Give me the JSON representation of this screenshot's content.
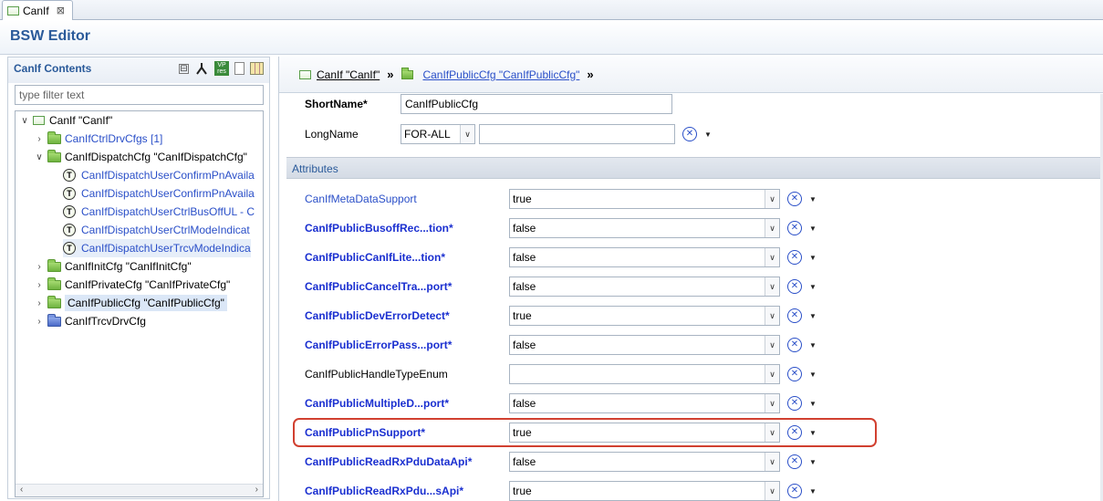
{
  "editor_tab": {
    "label": "CanIf",
    "close": "⊠"
  },
  "editor": {
    "title": "BSW Editor"
  },
  "left_panel": {
    "title": "CanIf Contents",
    "filter_placeholder": "type filter text",
    "toolbar": {
      "collapse": "⊟",
      "vp_top": "VP",
      "vp_bottom": "res"
    },
    "tree": {
      "root": {
        "label": "CanIf \"CanIf\"",
        "chevron": "∨"
      },
      "items": [
        {
          "label": "CanIfCtrlDrvCfgs [1]",
          "chevron": "›"
        },
        {
          "label": "CanIfDispatchCfg \"CanIfDispatchCfg\"",
          "chevron": "∨"
        },
        {
          "label": "CanIfDispatchUserConfirmPnAvaila",
          "icon": "T"
        },
        {
          "label": "CanIfDispatchUserConfirmPnAvaila",
          "icon": "T"
        },
        {
          "label": "CanIfDispatchUserCtrlBusOffUL - C",
          "icon": "T"
        },
        {
          "label": "CanIfDispatchUserCtrlModeIndicat",
          "icon": "T"
        },
        {
          "label": "CanIfDispatchUserTrcvModeIndica",
          "icon": "T"
        },
        {
          "label": "CanIfInitCfg \"CanIfInitCfg\"",
          "chevron": "›"
        },
        {
          "label": "CanIfPrivateCfg \"CanIfPrivateCfg\"",
          "chevron": "›"
        },
        {
          "label": "CanIfPublicCfg \"CanIfPublicCfg\"",
          "chevron": "›"
        },
        {
          "label": "CanIfTrcvDrvCfg",
          "chevron": "›"
        }
      ]
    },
    "scroll_left": "‹",
    "scroll_right": "›"
  },
  "breadcrumb": {
    "item1": "CanIf \"CanIf\"",
    "sep": "»",
    "item2": "CanIfPublicCfg \"CanIfPublicCfg\""
  },
  "form": {
    "shortname_label": "ShortName*",
    "shortname_value": "CanIfPublicCfg",
    "longname_label": "LongName",
    "longname_lang": "FOR-ALL",
    "longname_value": "",
    "section_title": "Attributes",
    "clear_symbol": "✕",
    "dropdown_symbol": "▼",
    "combo_arrow": "∨",
    "attributes": [
      {
        "label": "CanIfMetaDataSupport",
        "value": "true"
      },
      {
        "label": "CanIfPublicBusoffRec...tion*",
        "value": "false"
      },
      {
        "label": "CanIfPublicCanIfLite...tion*",
        "value": "false"
      },
      {
        "label": "CanIfPublicCancelTra...port*",
        "value": "false"
      },
      {
        "label": "CanIfPublicDevErrorDetect*",
        "value": "true"
      },
      {
        "label": "CanIfPublicErrorPass...port*",
        "value": "false"
      },
      {
        "label": "CanIfPublicHandleTypeEnum",
        "value": ""
      },
      {
        "label": "CanIfPublicMultipleD...port*",
        "value": "false"
      },
      {
        "label": "CanIfPublicPnSupport*",
        "value": "true"
      },
      {
        "label": "CanIfPublicReadRxPduDataApi*",
        "value": "false"
      },
      {
        "label": "CanIfPublicReadRxPdu...sApi*",
        "value": "true"
      }
    ]
  }
}
